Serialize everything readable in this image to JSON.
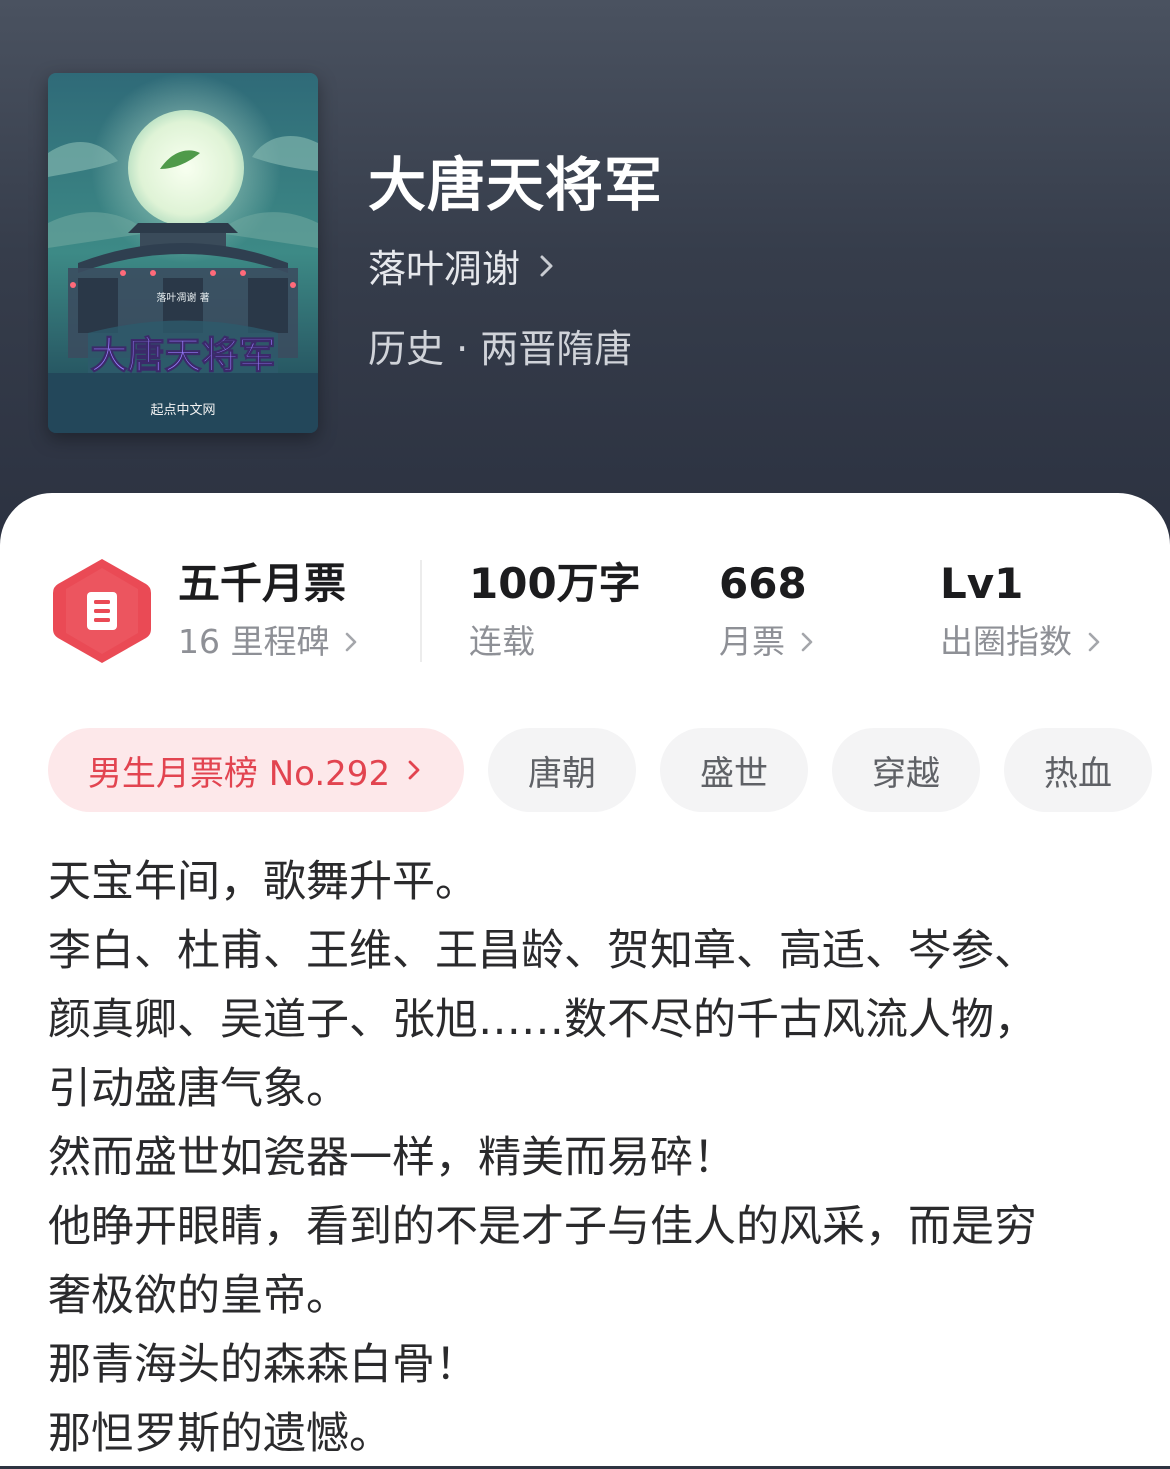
{
  "book": {
    "title": "大唐天将军",
    "author": "落叶凋谢",
    "genre": "历史 · 两晋隋唐"
  },
  "cover": {
    "author_line": "落叶凋谢 著",
    "title": "大唐天将军",
    "publisher": "起点中文网"
  },
  "stats": {
    "milestone": {
      "main": "五千月票",
      "sub": "16 里程碑"
    },
    "words": {
      "main": "100万字",
      "sub": "连载"
    },
    "votes": {
      "main": "668",
      "sub": "月票"
    },
    "influence": {
      "main": "Lv1",
      "sub": "出圈指数"
    }
  },
  "tags": {
    "rank": "男生月票榜 No.292",
    "items": [
      "唐朝",
      "盛世",
      "穿越",
      "热血"
    ]
  },
  "description": [
    "天宝年间，歌舞升平。",
    "李白、杜甫、王维、王昌龄、贺知章、高适、岑参、",
    "颜真卿、吴道子、张旭……数不尽的千古风流人物，",
    "引动盛唐气象。",
    "然而盛世如瓷器一样，精美而易碎！",
    "他睁开眼睛，看到的不是才子与佳人的风采，而是穷",
    "奢极欲的皇帝。",
    "那青海头的森森白骨！",
    "那怛罗斯的遗憾。"
  ],
  "colors": {
    "hero_bg": "#363d4b",
    "accent_red": "#e24450",
    "rank_bg": "#fde8ea",
    "tag_bg": "#f4f4f5"
  }
}
